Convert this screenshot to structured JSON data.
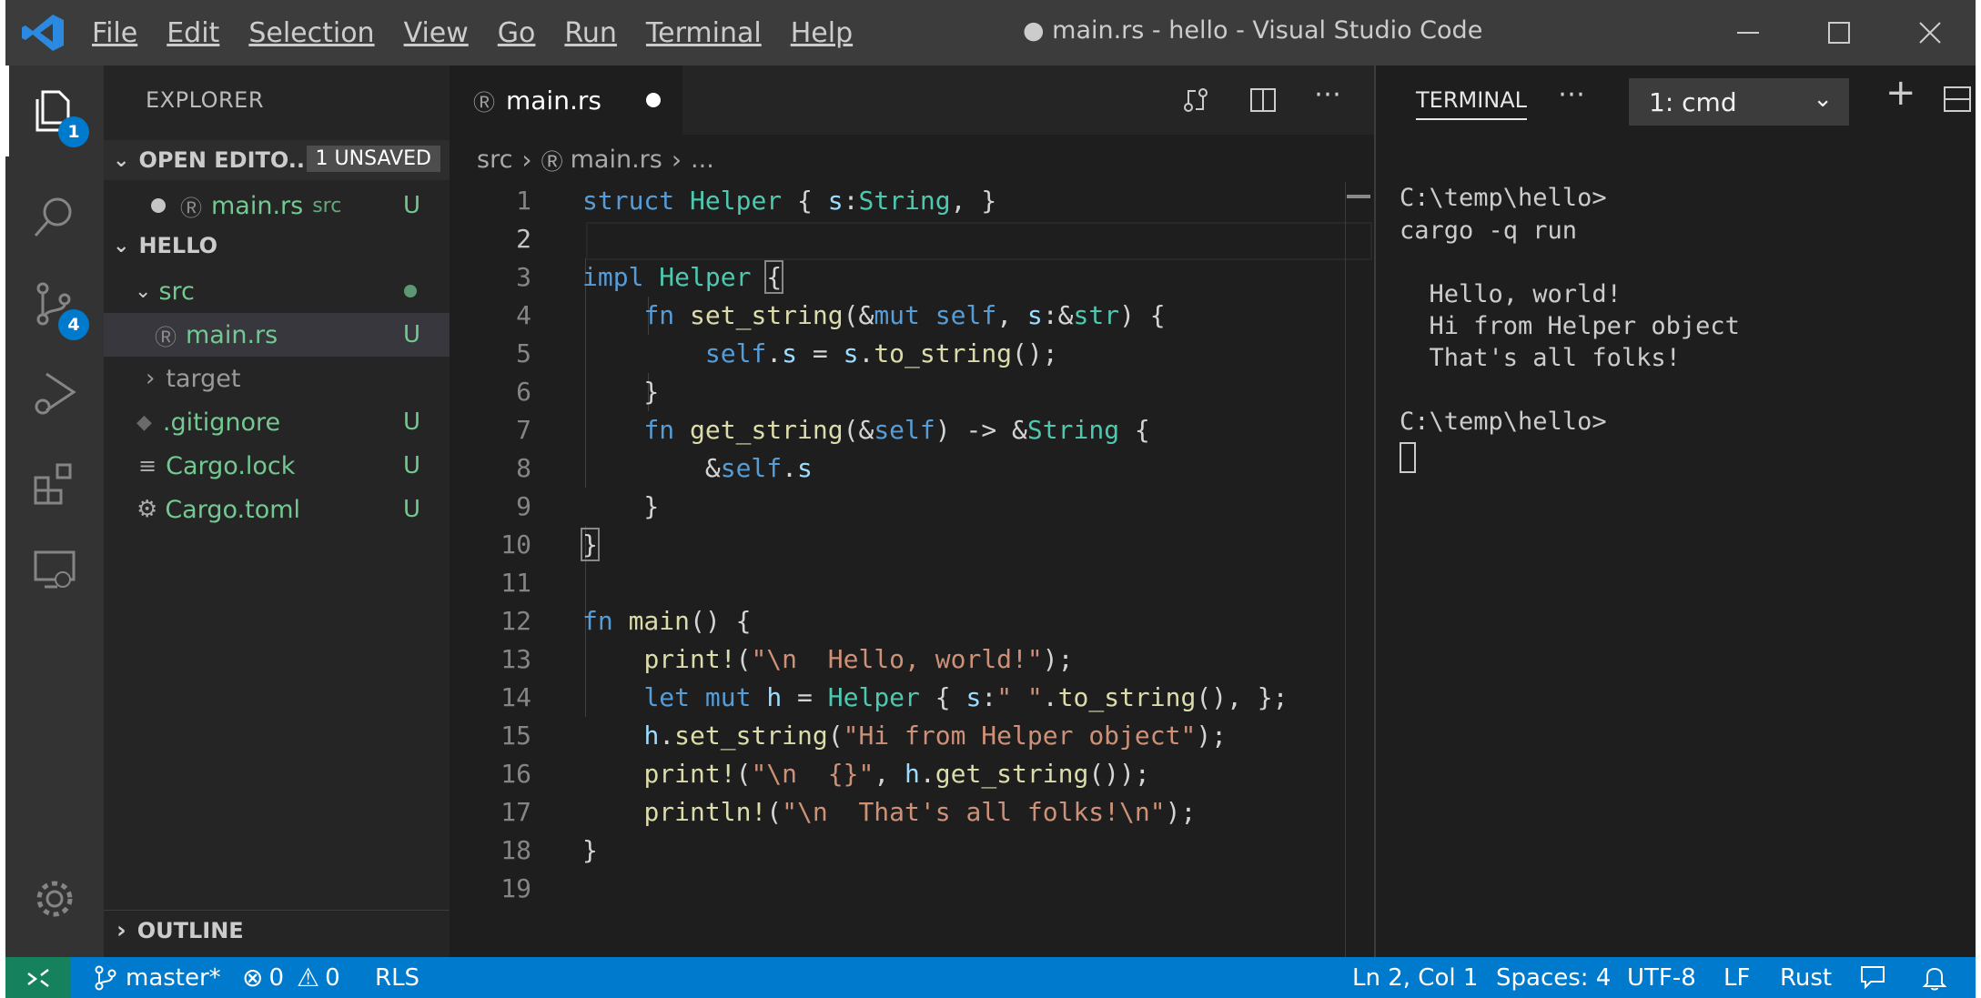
{
  "window": {
    "title": "● main.rs - hello - Visual Studio Code",
    "menu": [
      "File",
      "Edit",
      "Selection",
      "View",
      "Go",
      "Run",
      "Terminal",
      "Help"
    ]
  },
  "activity_bar": {
    "explorer_badge": "1",
    "source_control_badge": "4"
  },
  "sidebar": {
    "title": "EXPLORER",
    "open_editors": {
      "header": "OPEN EDITO...",
      "unsaved_badge": "1 UNSAVED",
      "file": "main.rs",
      "folder": "src",
      "status": "U"
    },
    "project": {
      "header": "HELLO",
      "items": [
        {
          "label": "src",
          "status": "●"
        },
        {
          "label": "main.rs",
          "status": "U"
        },
        {
          "label": "target",
          "status": ""
        },
        {
          "label": ".gitignore",
          "status": "U"
        },
        {
          "label": "Cargo.lock",
          "status": "U"
        },
        {
          "label": "Cargo.toml",
          "status": "U"
        }
      ]
    },
    "outline_header": "OUTLINE"
  },
  "editor": {
    "tab_label": "main.rs",
    "breadcrumb": {
      "folder": "src",
      "file": "main.rs",
      "tail": "..."
    },
    "line_numbers": [
      "1",
      "2",
      "3",
      "4",
      "5",
      "6",
      "7",
      "8",
      "9",
      "10",
      "11",
      "12",
      "13",
      "14",
      "15",
      "16",
      "17",
      "18",
      "19"
    ]
  },
  "terminal": {
    "tab_label": "TERMINAL",
    "instance": "1: cmd",
    "lines": [
      "C:\\temp\\hello>",
      "cargo -q run",
      "",
      "  Hello, world!",
      "  Hi from Helper object",
      "  That's all folks!",
      "",
      "C:\\temp\\hello>"
    ]
  },
  "statusbar": {
    "branch": "master*",
    "errors": "0",
    "warnings": "0",
    "rls": "RLS",
    "position": "Ln 2, Col 1",
    "spaces": "Spaces: 4",
    "encoding": "UTF-8",
    "eol": "LF",
    "language": "Rust"
  },
  "colors": {
    "accent": "#007acc",
    "git_untracked": "#73c991",
    "remote": "#16825d"
  }
}
